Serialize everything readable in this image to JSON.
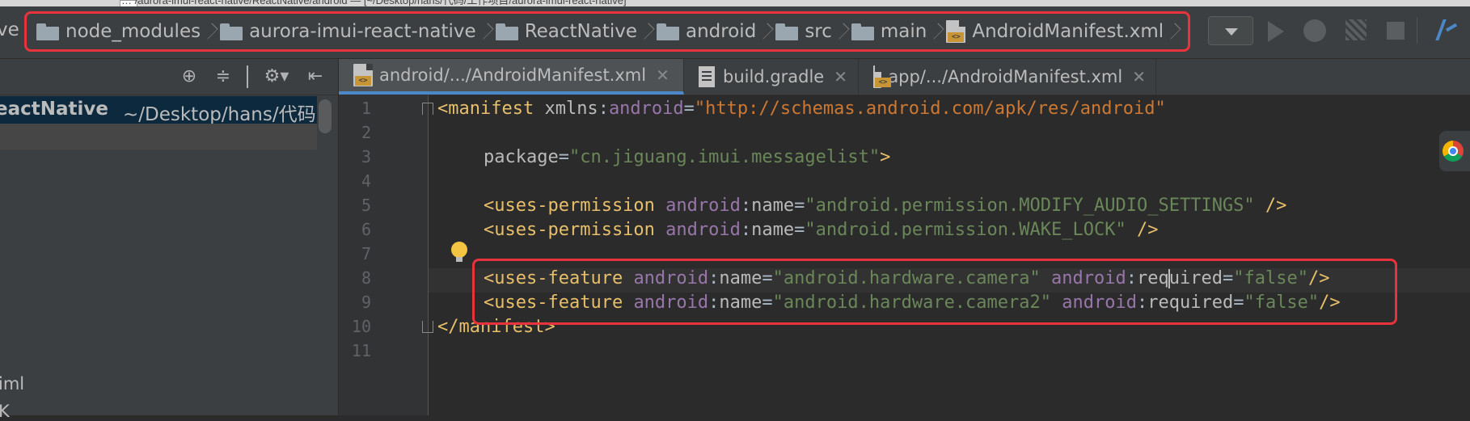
{
  "title_bar": {
    "text": "… /aurora-imui-react-native/ReactNative/android — [~/Desktop/hans/代码/工作项目/aurora-imui-react-native]"
  },
  "nav_bar": {
    "leading_text": "ve",
    "breadcrumbs": [
      {
        "label": "node_modules",
        "icon": "folder-icon"
      },
      {
        "label": "aurora-imui-react-native",
        "icon": "folder-icon"
      },
      {
        "label": "ReactNative",
        "icon": "folder-icon"
      },
      {
        "label": "android",
        "icon": "folder-icon"
      },
      {
        "label": "src",
        "icon": "folder-icon"
      },
      {
        "label": "main",
        "icon": "folder-icon"
      },
      {
        "label": "AndroidManifest.xml",
        "icon": "xml-file-icon"
      }
    ],
    "toolbar": [
      "run-config-dropdown",
      "run-icon",
      "debug-icon",
      "profile-icon",
      "stop-icon",
      "vcs-icon"
    ]
  },
  "project_panel": {
    "root_name": "eactNative",
    "root_path": "~/Desktop/hans/代码",
    "partial_items": [
      "iml",
      "K"
    ],
    "toolbar_icons": [
      "locate-icon",
      "collapse-icon",
      "settings-icon",
      "hide-icon"
    ]
  },
  "tabs": [
    {
      "label": "android/.../AndroidManifest.xml",
      "icon": "xml-file-icon",
      "active": true
    },
    {
      "label": "build.gradle",
      "icon": "gradle-file-icon",
      "active": false
    },
    {
      "label": "app/.../AndroidManifest.xml",
      "icon": "xml-file-icon",
      "active": false
    }
  ],
  "editor": {
    "line_numbers": [
      "1",
      "2",
      "3",
      "4",
      "5",
      "6",
      "7",
      "8",
      "9",
      "10",
      "11"
    ],
    "l1": {
      "open": "<manifest ",
      "ns": "xmlns",
      "colon": ":",
      "ns2": "android",
      "eq": "=",
      "val": "\"http://schemas.android.com/apk/res/android\""
    },
    "l3": {
      "attr": "package",
      "eq": "=",
      "val": "\"cn.jiguang.imui.messagelist\"",
      "close": ">"
    },
    "l5": {
      "open": "<uses-permission ",
      "ns": "android",
      "colon": ":",
      "attr": "name",
      "eq": "=",
      "val": "\"android.permission.MODIFY_AUDIO_SETTINGS\"",
      "close": " />"
    },
    "l6": {
      "open": "<uses-permission ",
      "ns": "android",
      "colon": ":",
      "attr": "name",
      "eq": "=",
      "val": "\"android.permission.WAKE_LOCK\"",
      "close": " />"
    },
    "l8": {
      "open": "<uses-feature ",
      "ns": "android",
      "colon": ":",
      "attr": "name",
      "eq": "=",
      "val": "\"android.hardware.camera\"",
      "sp": " ",
      "ns2": "android",
      "colon2": ":",
      "attr2a": "req",
      "attr2b": "uired",
      "eq2": "=",
      "val2": "\"false\"",
      "close": "/>"
    },
    "l9": {
      "open": "<uses-feature ",
      "ns": "android",
      "colon": ":",
      "attr": "name",
      "eq": "=",
      "val": "\"android.hardware.camera2\"",
      "sp": " ",
      "ns2": "android",
      "colon2": ":",
      "attr2": "required",
      "eq2": "=",
      "val2": "\"false\"",
      "close": "/>"
    },
    "l10": {
      "close": "</manifest>"
    }
  },
  "colors": {
    "highlight_border": "#e8333d",
    "tag": "#e8bf6a",
    "namespace": "#9876aa",
    "string": "#6a8759",
    "url": "#cc7832",
    "background": "#2b2b2b"
  }
}
